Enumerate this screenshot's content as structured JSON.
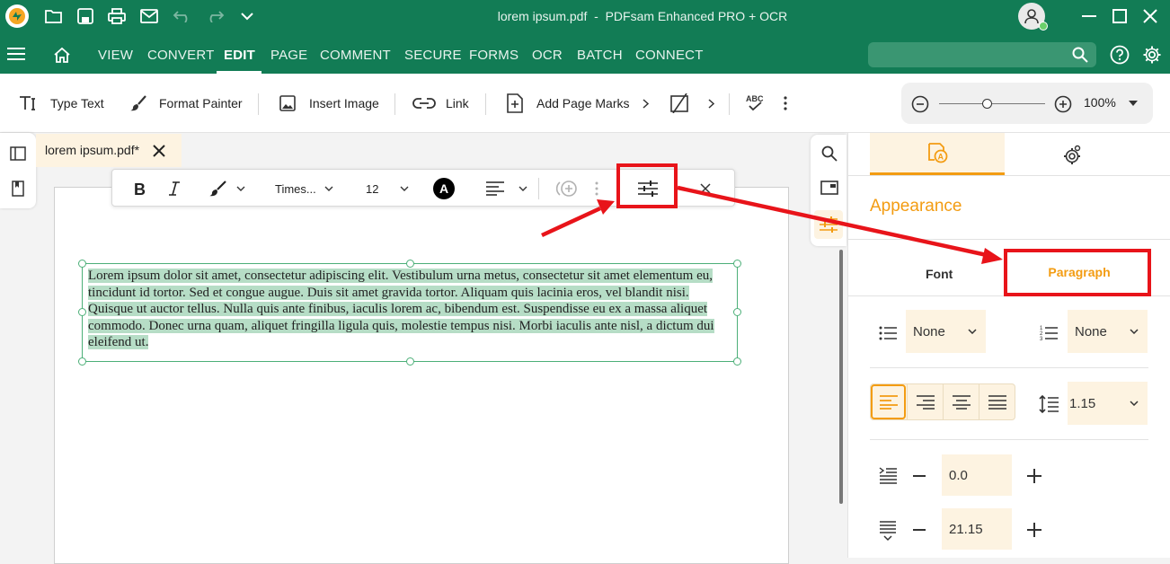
{
  "titlebar": {
    "title": "lorem ipsum.pdf  -  PDFsam Enhanced PRO + OCR",
    "icons": [
      "app-logo",
      "open-icon",
      "save-icon",
      "print-icon",
      "email-icon",
      "undo-icon",
      "redo-icon",
      "chevron-down-icon",
      "user-avatar",
      "minimize-icon",
      "maximize-icon",
      "close-icon"
    ]
  },
  "menu": {
    "tabs": [
      "VIEW",
      "CONVERT",
      "EDIT",
      "PAGE",
      "COMMENT",
      "SECURE",
      "FORMS",
      "OCR",
      "BATCH",
      "CONNECT"
    ],
    "active": "EDIT",
    "search_placeholder": ""
  },
  "ribbon": {
    "type_text": "Type Text",
    "format_painter": "Format Painter",
    "insert_image": "Insert Image",
    "link": "Link",
    "add_page_marks": "Add Page Marks",
    "zoom": "100%",
    "zoom_level": 0.45
  },
  "document": {
    "tab_label": "lorem ipsum.pdf*",
    "paragraph": "Lorem ipsum dolor sit amet, consectetur adipiscing elit. Vestibulum urna metus, consectetur sit amet elementum eu, tincidunt id tortor. Sed et congue augue. Duis sit amet gravida tortor. Aliquam quis lacinia eros, vel blandit nisi. Quisque ut auctor tellus. Nulla quis ante finibus, iaculis lorem ac, bibendum est. Suspendisse eu ex a massa aliquet commodo. Donec urna quam, aliquet fringilla ligula quis, molestie tempus nisi. Morbi iaculis ante nisl, a dictum dui eleifend ut."
  },
  "format_toolbar": {
    "font": "Times...",
    "size": "12",
    "color_letter": "A"
  },
  "panel": {
    "title": "Appearance",
    "tab_font": "Font",
    "tab_paragraph": "Paragraph",
    "bullet_list": "None",
    "numbered_list": "None",
    "line_spacing": "1.15",
    "indent": "0.0",
    "spacing": "21.15"
  },
  "colors": {
    "brand_green": "#127c55",
    "accent_orange": "#f39c12",
    "highlight_red": "#e8141a",
    "selection": "#b6ddc6"
  }
}
